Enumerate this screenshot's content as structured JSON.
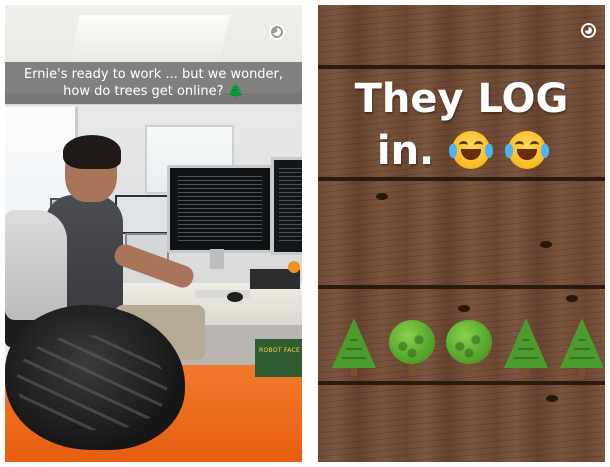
{
  "left_snap": {
    "caption": "Ernie's ready to work ... but we wonder, how do trees get online? 🌲",
    "timer_icon": "snap-timer-icon",
    "book_label": "ROBOT FACE"
  },
  "right_snap": {
    "headline_line1": "They LOG",
    "headline_line2": "in.",
    "emojis": [
      "face-with-tears-of-joy",
      "face-with-tears-of-joy"
    ],
    "tree_emojis": [
      "evergreen-tree",
      "deciduous-tree",
      "deciduous-tree",
      "evergreen-tree",
      "evergreen-tree"
    ],
    "timer_icon": "snap-timer-icon",
    "background": "wooden-planks"
  },
  "colors": {
    "caption_bar": "#3c3c3c",
    "ottoman": "#ee6c1f",
    "wood": "#6f4b35",
    "tree_green": "#4c9b2e",
    "text": "#ffffff"
  }
}
